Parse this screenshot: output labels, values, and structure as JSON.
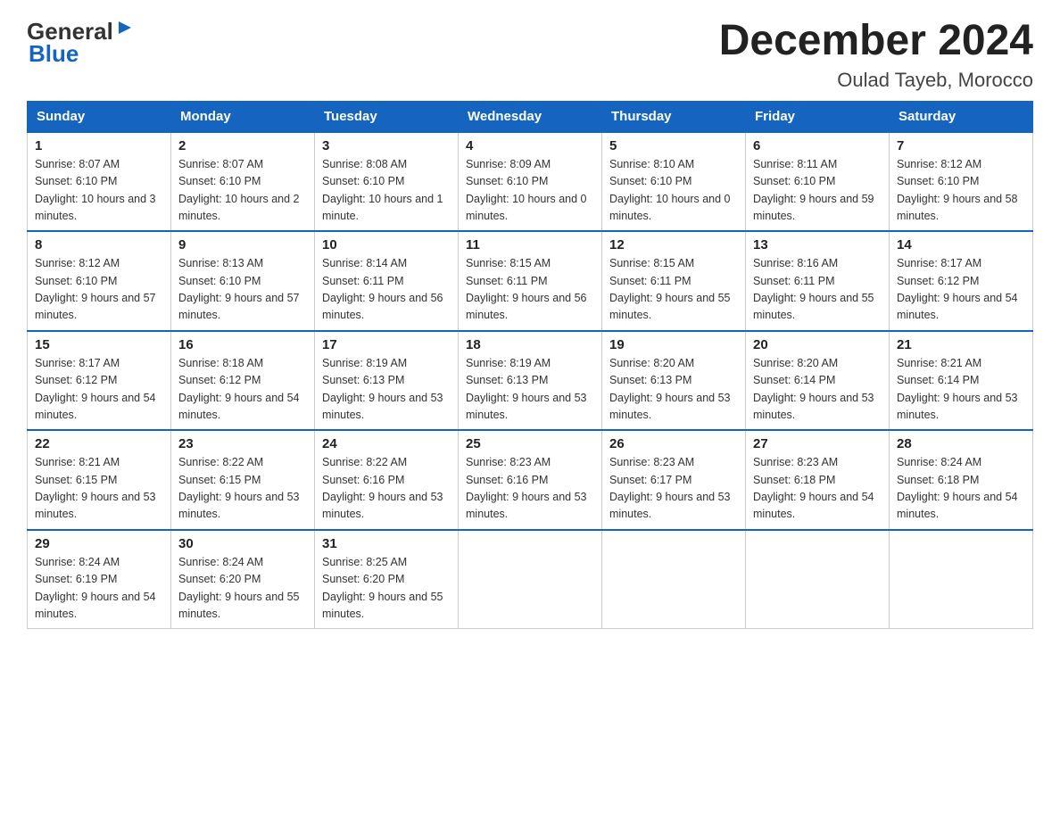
{
  "header": {
    "logo_general": "General",
    "logo_blue": "Blue",
    "month_title": "December 2024",
    "location": "Oulad Tayeb, Morocco"
  },
  "days_of_week": [
    "Sunday",
    "Monday",
    "Tuesday",
    "Wednesday",
    "Thursday",
    "Friday",
    "Saturday"
  ],
  "weeks": [
    [
      {
        "day": "1",
        "sunrise": "8:07 AM",
        "sunset": "6:10 PM",
        "daylight": "10 hours and 3 minutes."
      },
      {
        "day": "2",
        "sunrise": "8:07 AM",
        "sunset": "6:10 PM",
        "daylight": "10 hours and 2 minutes."
      },
      {
        "day": "3",
        "sunrise": "8:08 AM",
        "sunset": "6:10 PM",
        "daylight": "10 hours and 1 minute."
      },
      {
        "day": "4",
        "sunrise": "8:09 AM",
        "sunset": "6:10 PM",
        "daylight": "10 hours and 0 minutes."
      },
      {
        "day": "5",
        "sunrise": "8:10 AM",
        "sunset": "6:10 PM",
        "daylight": "10 hours and 0 minutes."
      },
      {
        "day": "6",
        "sunrise": "8:11 AM",
        "sunset": "6:10 PM",
        "daylight": "9 hours and 59 minutes."
      },
      {
        "day": "7",
        "sunrise": "8:12 AM",
        "sunset": "6:10 PM",
        "daylight": "9 hours and 58 minutes."
      }
    ],
    [
      {
        "day": "8",
        "sunrise": "8:12 AM",
        "sunset": "6:10 PM",
        "daylight": "9 hours and 57 minutes."
      },
      {
        "day": "9",
        "sunrise": "8:13 AM",
        "sunset": "6:10 PM",
        "daylight": "9 hours and 57 minutes."
      },
      {
        "day": "10",
        "sunrise": "8:14 AM",
        "sunset": "6:11 PM",
        "daylight": "9 hours and 56 minutes."
      },
      {
        "day": "11",
        "sunrise": "8:15 AM",
        "sunset": "6:11 PM",
        "daylight": "9 hours and 56 minutes."
      },
      {
        "day": "12",
        "sunrise": "8:15 AM",
        "sunset": "6:11 PM",
        "daylight": "9 hours and 55 minutes."
      },
      {
        "day": "13",
        "sunrise": "8:16 AM",
        "sunset": "6:11 PM",
        "daylight": "9 hours and 55 minutes."
      },
      {
        "day": "14",
        "sunrise": "8:17 AM",
        "sunset": "6:12 PM",
        "daylight": "9 hours and 54 minutes."
      }
    ],
    [
      {
        "day": "15",
        "sunrise": "8:17 AM",
        "sunset": "6:12 PM",
        "daylight": "9 hours and 54 minutes."
      },
      {
        "day": "16",
        "sunrise": "8:18 AM",
        "sunset": "6:12 PM",
        "daylight": "9 hours and 54 minutes."
      },
      {
        "day": "17",
        "sunrise": "8:19 AM",
        "sunset": "6:13 PM",
        "daylight": "9 hours and 53 minutes."
      },
      {
        "day": "18",
        "sunrise": "8:19 AM",
        "sunset": "6:13 PM",
        "daylight": "9 hours and 53 minutes."
      },
      {
        "day": "19",
        "sunrise": "8:20 AM",
        "sunset": "6:13 PM",
        "daylight": "9 hours and 53 minutes."
      },
      {
        "day": "20",
        "sunrise": "8:20 AM",
        "sunset": "6:14 PM",
        "daylight": "9 hours and 53 minutes."
      },
      {
        "day": "21",
        "sunrise": "8:21 AM",
        "sunset": "6:14 PM",
        "daylight": "9 hours and 53 minutes."
      }
    ],
    [
      {
        "day": "22",
        "sunrise": "8:21 AM",
        "sunset": "6:15 PM",
        "daylight": "9 hours and 53 minutes."
      },
      {
        "day": "23",
        "sunrise": "8:22 AM",
        "sunset": "6:15 PM",
        "daylight": "9 hours and 53 minutes."
      },
      {
        "day": "24",
        "sunrise": "8:22 AM",
        "sunset": "6:16 PM",
        "daylight": "9 hours and 53 minutes."
      },
      {
        "day": "25",
        "sunrise": "8:23 AM",
        "sunset": "6:16 PM",
        "daylight": "9 hours and 53 minutes."
      },
      {
        "day": "26",
        "sunrise": "8:23 AM",
        "sunset": "6:17 PM",
        "daylight": "9 hours and 53 minutes."
      },
      {
        "day": "27",
        "sunrise": "8:23 AM",
        "sunset": "6:18 PM",
        "daylight": "9 hours and 54 minutes."
      },
      {
        "day": "28",
        "sunrise": "8:24 AM",
        "sunset": "6:18 PM",
        "daylight": "9 hours and 54 minutes."
      }
    ],
    [
      {
        "day": "29",
        "sunrise": "8:24 AM",
        "sunset": "6:19 PM",
        "daylight": "9 hours and 54 minutes."
      },
      {
        "day": "30",
        "sunrise": "8:24 AM",
        "sunset": "6:20 PM",
        "daylight": "9 hours and 55 minutes."
      },
      {
        "day": "31",
        "sunrise": "8:25 AM",
        "sunset": "6:20 PM",
        "daylight": "9 hours and 55 minutes."
      },
      null,
      null,
      null,
      null
    ]
  ]
}
